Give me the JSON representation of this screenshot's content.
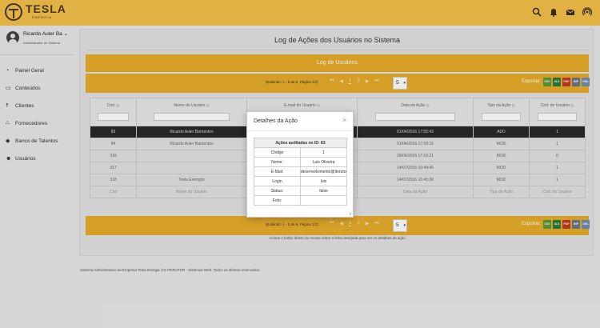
{
  "brand": {
    "name": "TESLA",
    "sub": "ENERGIA"
  },
  "topbar": {
    "icons": [
      "search-icon",
      "bell-icon",
      "mail-icon",
      "broadcast-icon"
    ]
  },
  "user": {
    "name": "Ricardo Auler Ba",
    "caret": "⌄",
    "role": "Administrador do Sistema"
  },
  "menu": [
    {
      "label": "Painel Geral",
      "icon": "dashboard-icon"
    },
    {
      "label": "Conteúdos",
      "icon": "monitor-icon"
    },
    {
      "label": "Clientes",
      "icon": "person-icon"
    },
    {
      "label": "Fornecedores",
      "icon": "sitemap-icon"
    },
    {
      "label": "Banco de Talentos",
      "icon": "graduation-icon"
    },
    {
      "label": "Usuários",
      "icon": "users-icon"
    }
  ],
  "page": {
    "title": "Log de Ações dos Usuários no Sistema",
    "card_title": "Log de Usuários"
  },
  "pager": {
    "info": "(Exibindo: 1 - 5 de 6, Página 1/2)",
    "page_current": "1",
    "page_next": "2",
    "rows_per_page": "5",
    "export_label": "Exportar:",
    "export_formats": [
      "CSV",
      "XLS",
      "PDF",
      "IMP",
      "XML"
    ]
  },
  "table": {
    "headers": [
      "Cód.",
      "Nome do Usuário",
      "E-mail do Usuário",
      "Data da Ação",
      "Tipo da Ação",
      "Cód. do Usuário"
    ],
    "rows": [
      [
        "83",
        "Ricardo Auler Barrientos",
        "",
        "01/04/2016 17:55:43",
        "ADD",
        "1"
      ],
      [
        "84",
        "Ricardo Auler Barrientos",
        "",
        "01/04/2016 17:59:15",
        "MOD",
        "1"
      ],
      [
        "316",
        "",
        "",
        "28/06/2016 17:16:21",
        "MOD",
        "0"
      ],
      [
        "317",
        "",
        "",
        "14/07/2016 16:44:45",
        "MOD",
        "1"
      ],
      [
        "318",
        "Tesla Exemplo",
        "",
        "14/07/2016 16:45:30",
        "MOD",
        "1"
      ]
    ],
    "footer": [
      "Cód",
      "Nome do Usuário",
      "",
      "Data da Ação",
      "Tipo da Ação",
      "Cód. do Usuário"
    ]
  },
  "hint": "Acione o botão direito do mouse sobre a linha desejada para ver os detalhes da ação",
  "footer": "Sistema Administrativo da Empresa Tesla Energia | ID ITERATOR - Sistemas Web. Todos os direitos reservados.",
  "modal": {
    "title": "Detalhes da Ação",
    "close": "×",
    "table_title": "Ações auditadas no ID: 83",
    "fields": [
      {
        "key": "Código",
        "value": "1"
      },
      {
        "key": "Nome:",
        "value": "Luis Oliveira"
      },
      {
        "key": "E-Mail:",
        "value": "desenvolvimento@iterator.com.br"
      },
      {
        "key": "Login",
        "value": "luis"
      },
      {
        "key": "Status:",
        "value": "false"
      },
      {
        "key": "Foto:",
        "value": ""
      }
    ]
  }
}
